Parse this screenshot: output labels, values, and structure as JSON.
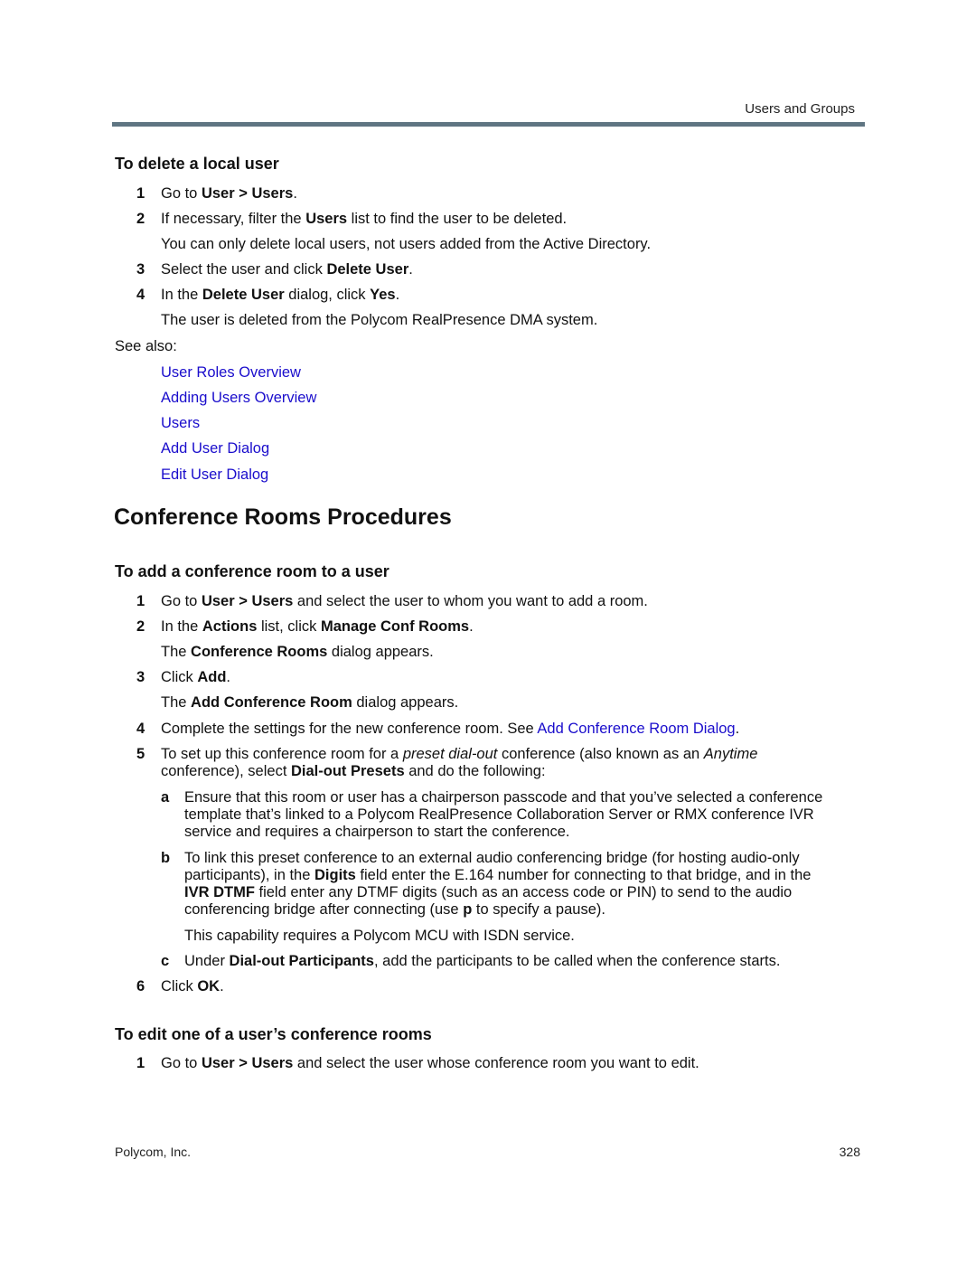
{
  "header": {
    "section": "Users and Groups"
  },
  "delete_user": {
    "heading": "To delete a local user",
    "steps": [
      {
        "num": "1",
        "parts": [
          "Go to ",
          "User > Users",
          "."
        ]
      },
      {
        "num": "2",
        "parts": [
          "If necessary, filter the ",
          "Users",
          " list to find the user to be deleted."
        ],
        "note": "You can only delete local users, not users added from the Active Directory."
      },
      {
        "num": "3",
        "parts": [
          "Select the user and click ",
          "Delete User",
          "."
        ]
      },
      {
        "num": "4",
        "parts": [
          "In the ",
          "Delete User",
          " dialog, click ",
          "Yes",
          "."
        ],
        "note": "The user is deleted from the Polycom RealPresence DMA system."
      }
    ],
    "see_also_label": "See also:",
    "see_also_links": [
      "User Roles Overview",
      "Adding Users Overview",
      "Users",
      "Add User Dialog",
      "Edit User Dialog"
    ]
  },
  "conference_rooms": {
    "title": "Conference Rooms Procedures",
    "add_room": {
      "heading": "To add a conference room to a user",
      "steps": [
        {
          "num": "1",
          "parts": [
            "Go to ",
            "User > Users",
            " and select the user to whom you want to add a room."
          ]
        },
        {
          "num": "2",
          "parts": [
            "In the ",
            "Actions",
            " list, click ",
            "Manage Conf Rooms",
            "."
          ],
          "note_parts": [
            "The ",
            "Conference Rooms",
            " dialog appears."
          ]
        },
        {
          "num": "3",
          "parts": [
            "Click ",
            "Add",
            "."
          ],
          "note_parts": [
            "The ",
            "Add Conference Room",
            " dialog appears."
          ]
        },
        {
          "num": "4",
          "parts": [
            "Complete the settings for the new conference room. See ",
            "Add Conference Room Dialog",
            "."
          ]
        },
        {
          "num": "5",
          "line1_parts": [
            "To set up this conference room for a ",
            "preset dial-out",
            " conference (also known as an ",
            "Anytime"
          ],
          "line2_parts": [
            "conference), select ",
            "Dial-out Presets",
            " and do the following:"
          ]
        },
        {
          "num": "6",
          "parts": [
            "Click ",
            "OK",
            "."
          ]
        }
      ],
      "substeps": [
        {
          "letter": "a",
          "lines": [
            "Ensure that this room or user has a chairperson passcode and that you’ve selected a conference",
            "template that’s linked to a Polycom RealPresence Collaboration Server or RMX conference IVR",
            "service and requires a chairperson to start the conference."
          ]
        },
        {
          "letter": "b",
          "line1": "To link this preset conference to an external audio conferencing bridge (for hosting audio-only",
          "line2_parts": [
            "participants), in the ",
            "Digits",
            " field enter the E.164 number for connecting to that bridge, and in the"
          ],
          "line3_parts": [
            "IVR DTMF",
            " field enter any DTMF digits (such as an access code or PIN) to send to the audio"
          ],
          "line4_parts": [
            "conferencing bridge after connecting (use ",
            "p",
            " to specify a pause)."
          ],
          "note": "This capability requires a Polycom MCU with ISDN service."
        },
        {
          "letter": "c",
          "parts": [
            "Under ",
            "Dial-out Participants",
            ", add the participants to be called when the conference starts."
          ]
        }
      ]
    },
    "edit_room": {
      "heading": "To edit one of a user’s conference rooms",
      "steps": [
        {
          "num": "1",
          "parts": [
            "Go to ",
            "User > Users",
            " and select the user whose conference room you want to edit."
          ]
        }
      ]
    }
  },
  "footer": {
    "company": "Polycom, Inc.",
    "page": "328"
  }
}
